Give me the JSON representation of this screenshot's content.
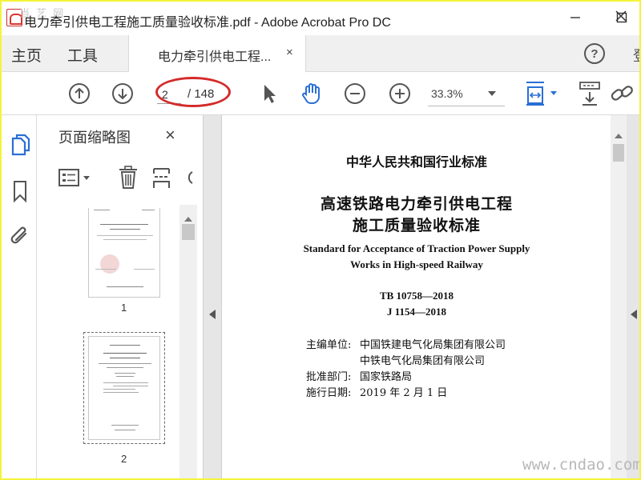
{
  "window": {
    "title": "电力牵引供电工程施工质量验收标准.pdf - Adobe Acrobat Pro DC",
    "watermark_top": "当 艺 网",
    "minimize_icon": "minimize-icon",
    "maximize_icon": "maximize-icon",
    "close_icon": "close-icon"
  },
  "nav": {
    "home": "主页",
    "tools": "工具",
    "doc_tab_label": "电力牵引供电工程...",
    "doc_tab_close": "×",
    "help": "?",
    "cutoff": "登"
  },
  "toolbar": {
    "current_page": "2",
    "total_pages": "/ 148",
    "zoom": "33.3%",
    "highlight_color": "#d42a2a"
  },
  "thumbnail_panel": {
    "title": "页面缩略图",
    "close": "×",
    "thumbs": [
      {
        "label": "1"
      },
      {
        "label": "2"
      }
    ]
  },
  "document": {
    "heading": "中华人民共和国行业标准",
    "title_line1": "高速铁路电力牵引供电工程",
    "title_line2": "施工质量验收标准",
    "en_line1": "Standard for Acceptance of Traction Power Supply",
    "en_line2": "Works in High-speed Railway",
    "code1": "TB 10758—2018",
    "code2": "J 1154—2018",
    "editor_label": "主编单位:",
    "editor1": "中国铁建电气化局集团有限公司",
    "editor2": "中铁电气化局集团有限公司",
    "approver_label": "批准部门:",
    "approver": "国家铁路局",
    "date_label": "施行日期:",
    "date": "2019 年 2 月 1 日"
  },
  "watermark_bottom": "www.cndao.com",
  "colors": {
    "outer_border": "#f4f43a",
    "accent_blue": "#2a6fd6"
  }
}
